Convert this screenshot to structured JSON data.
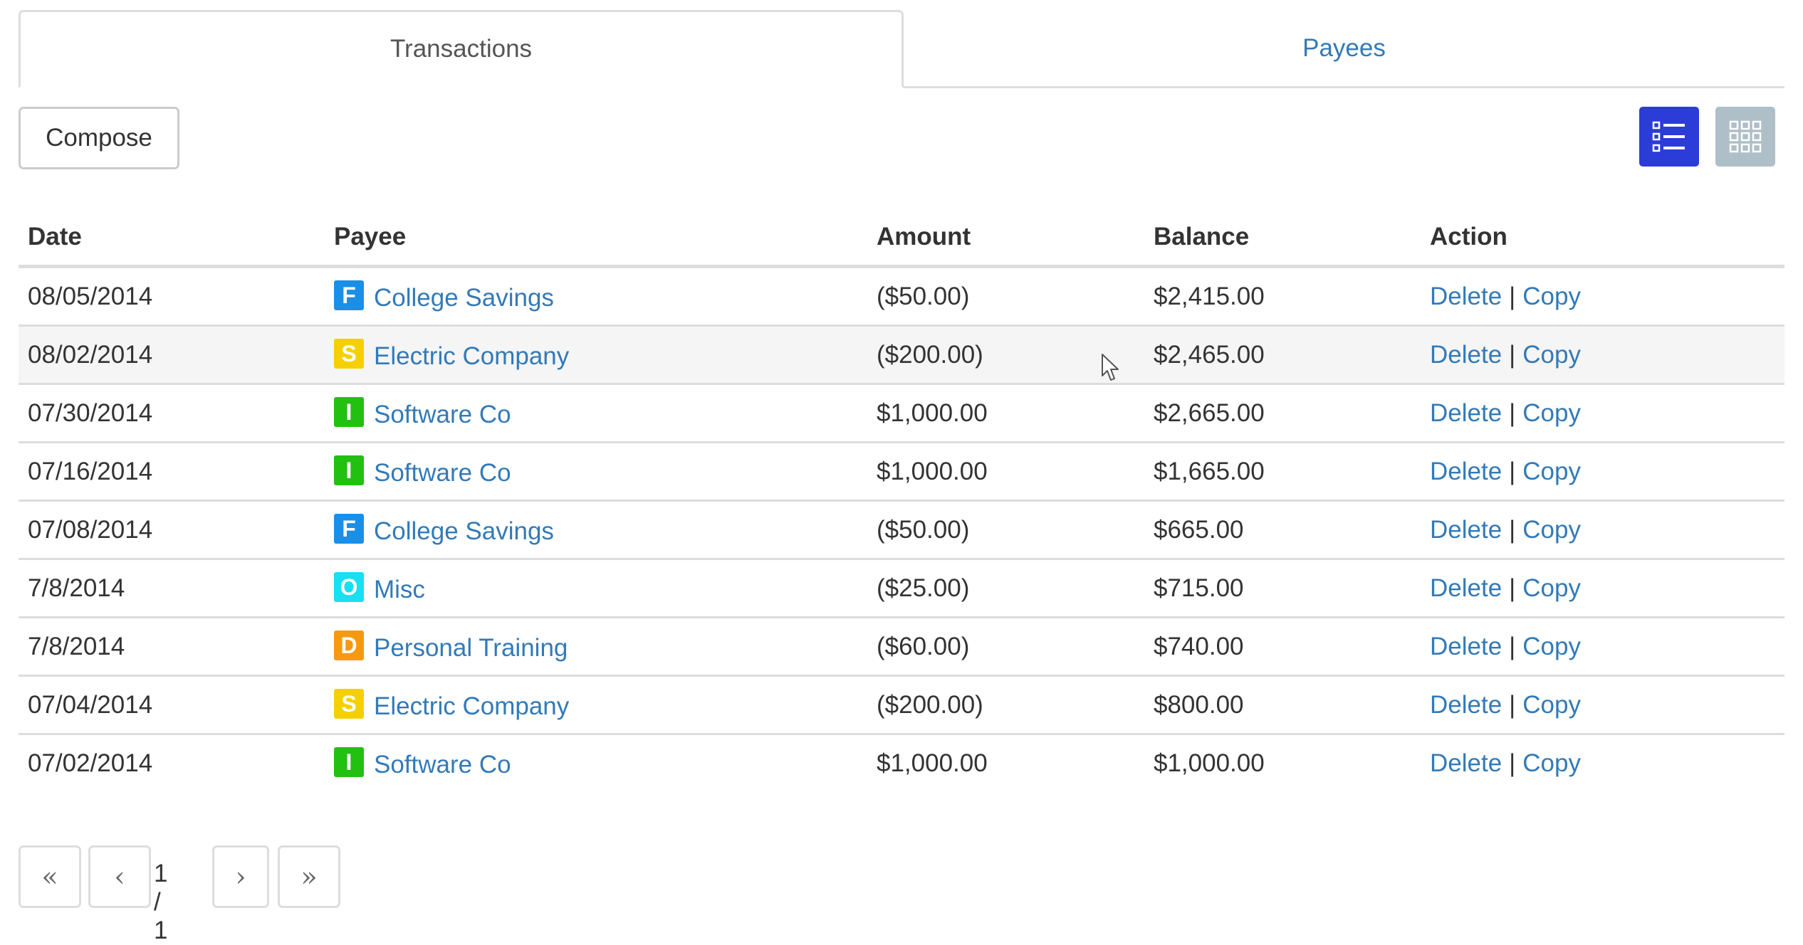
{
  "tabs": [
    {
      "label": "Transactions",
      "active": true
    },
    {
      "label": "Payees",
      "active": false
    }
  ],
  "toolbar": {
    "compose_label": "Compose",
    "view_list_icon": "list-view-icon",
    "view_grid_icon": "grid-view-icon"
  },
  "table": {
    "headers": {
      "date": "Date",
      "payee": "Payee",
      "amount": "Amount",
      "balance": "Balance",
      "action": "Action"
    },
    "rows": [
      {
        "date": "08/05/2014",
        "badge": "F",
        "badge_color": "#1a8fe8",
        "payee": "College Savings",
        "amount": "($50.00)",
        "balance": "$2,415.00",
        "delete": "Delete",
        "sep": "|",
        "copy": "Copy"
      },
      {
        "date": "08/02/2014",
        "badge": "S",
        "badge_color": "#f5d000",
        "payee": "Electric Company",
        "amount": "($200.00)",
        "balance": "$2,465.00",
        "delete": "Delete",
        "sep": "|",
        "copy": "Copy"
      },
      {
        "date": "07/30/2014",
        "badge": "I",
        "badge_color": "#22c010",
        "payee": "Software Co",
        "amount": "$1,000.00",
        "balance": "$2,665.00",
        "delete": "Delete",
        "sep": "|",
        "copy": "Copy"
      },
      {
        "date": "07/16/2014",
        "badge": "I",
        "badge_color": "#22c010",
        "payee": "Software Co",
        "amount": "$1,000.00",
        "balance": "$1,665.00",
        "delete": "Delete",
        "sep": "|",
        "copy": "Copy"
      },
      {
        "date": "07/08/2014",
        "badge": "F",
        "badge_color": "#1a8fe8",
        "payee": "College Savings",
        "amount": "($50.00)",
        "balance": "$665.00",
        "delete": "Delete",
        "sep": "|",
        "copy": "Copy"
      },
      {
        "date": "7/8/2014",
        "badge": "O",
        "badge_color": "#18e0f0",
        "payee": "Misc",
        "amount": "($25.00)",
        "balance": "$715.00",
        "delete": "Delete",
        "sep": "|",
        "copy": "Copy"
      },
      {
        "date": "7/8/2014",
        "badge": "D",
        "badge_color": "#f59a10",
        "payee": "Personal Training",
        "amount": "($60.00)",
        "balance": "$740.00",
        "delete": "Delete",
        "sep": "|",
        "copy": "Copy"
      },
      {
        "date": "07/04/2014",
        "badge": "S",
        "badge_color": "#f5d000",
        "payee": "Electric Company",
        "amount": "($200.00)",
        "balance": "$800.00",
        "delete": "Delete",
        "sep": "|",
        "copy": "Copy"
      },
      {
        "date": "07/02/2014",
        "badge": "I",
        "badge_color": "#22c010",
        "payee": "Software Co",
        "amount": "$1,000.00",
        "balance": "$1,000.00",
        "delete": "Delete",
        "sep": "|",
        "copy": "Copy"
      }
    ]
  },
  "pagination": {
    "first": "«",
    "prev": "‹",
    "page_text": "1 / 1",
    "next": "›",
    "last": "»"
  },
  "colors": {
    "link": "#337ab7",
    "list_view_active": "#2b3cd9",
    "grid_view_inactive": "#aebfc8"
  }
}
